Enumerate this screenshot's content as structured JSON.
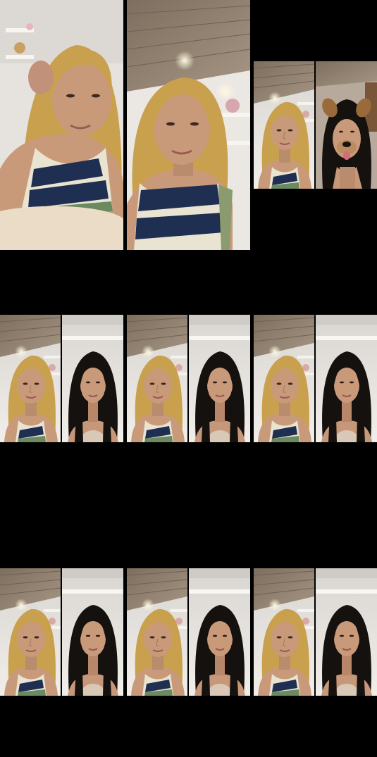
{
  "grid": {
    "background": "#000000",
    "frames": [
      {
        "id": "frame-1",
        "layout": "single",
        "people": [
          "blonde-woman"
        ],
        "scene": "bedroom-ceiling"
      },
      {
        "id": "frame-2",
        "layout": "single",
        "people": [
          "blonde-woman"
        ],
        "scene": "wood-ceiling-lights"
      },
      {
        "id": "frame-3",
        "layout": "split",
        "people": [
          "blonde-woman",
          "dark-haired-woman-dog-filter"
        ]
      },
      {
        "id": "frame-4",
        "layout": "split",
        "people": [
          "blonde-woman",
          "dark-haired-woman"
        ]
      },
      {
        "id": "frame-5",
        "layout": "split",
        "people": [
          "blonde-woman",
          "dark-haired-woman"
        ]
      },
      {
        "id": "frame-6",
        "layout": "split",
        "people": [
          "blonde-woman",
          "dark-haired-woman"
        ]
      },
      {
        "id": "frame-7",
        "layout": "split",
        "people": [
          "blonde-woman",
          "dark-haired-woman"
        ]
      },
      {
        "id": "frame-8",
        "layout": "split",
        "people": [
          "blonde-woman",
          "dark-haired-woman"
        ]
      },
      {
        "id": "frame-9",
        "layout": "split",
        "people": [
          "blonde-woman",
          "dark-haired-woman"
        ]
      }
    ],
    "colors": {
      "skin": "#c99a7a",
      "blonde_hair": "#c9a04e",
      "dark_hair": "#15110f",
      "wall": "#e7e3de",
      "wood": "#8a7a68",
      "top_navy": "#1f2f52",
      "top_cream": "#e9e3d2"
    }
  }
}
